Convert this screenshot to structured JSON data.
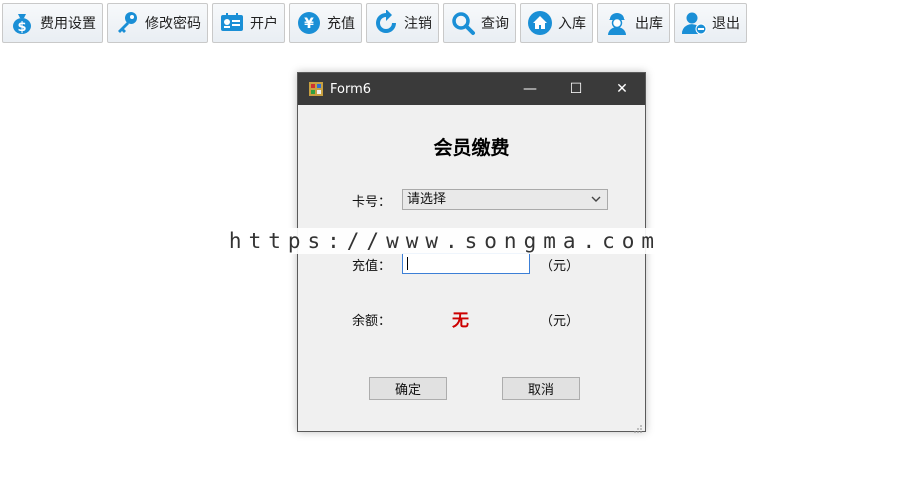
{
  "toolbar": {
    "items": [
      {
        "label": "费用设置",
        "icon": "money-bag-icon"
      },
      {
        "label": "修改密码",
        "icon": "key-icon"
      },
      {
        "label": "开户",
        "icon": "id-card-icon"
      },
      {
        "label": "充值",
        "icon": "yen-coin-icon"
      },
      {
        "label": "注销",
        "icon": "refresh-icon"
      },
      {
        "label": "查询",
        "icon": "search-icon"
      },
      {
        "label": "入库",
        "icon": "home-icon"
      },
      {
        "label": "出库",
        "icon": "worker-icon"
      },
      {
        "label": "退出",
        "icon": "user-logout-icon"
      }
    ]
  },
  "window": {
    "title": "Form6",
    "minimize": "—",
    "maximize": "☐",
    "close": "✕"
  },
  "form": {
    "heading": "会员缴费",
    "card_label": "卡号：",
    "card_select_value": "请选择",
    "recharge_label": "充值：",
    "recharge_value": "",
    "recharge_unit": "（元）",
    "balance_label": "余额：",
    "balance_value": "无",
    "balance_unit": "（元）",
    "confirm_label": "确定",
    "cancel_label": "取消"
  },
  "watermark": "https://www.songma.com",
  "colors": {
    "accent_blue": "#1a8fd6",
    "balance_red": "#cc0000",
    "titlebar": "#3a3a3a"
  }
}
